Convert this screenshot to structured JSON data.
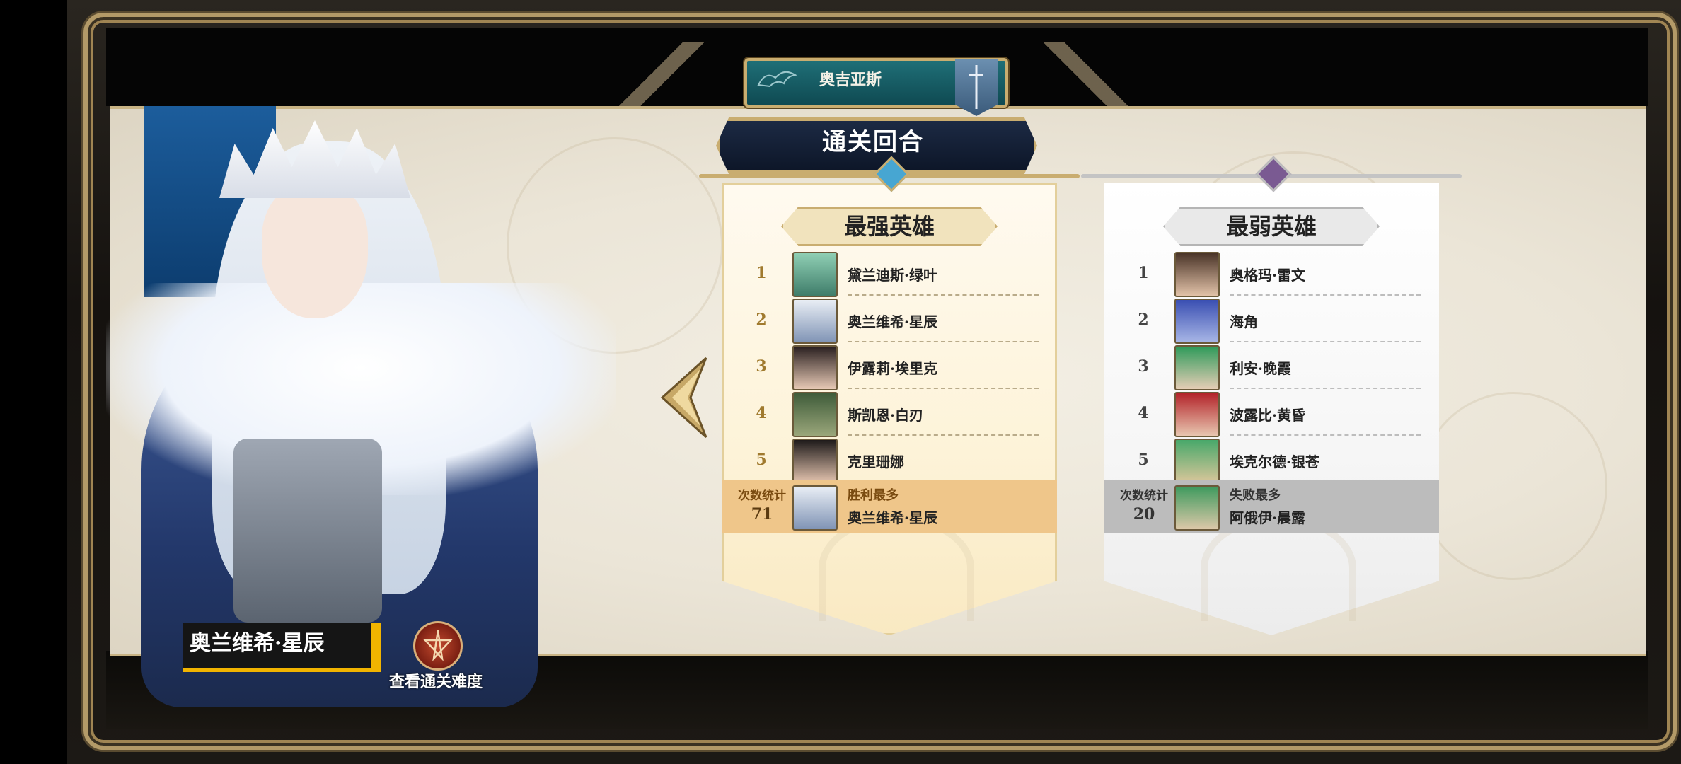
{
  "region": {
    "name": "奥吉亚斯"
  },
  "banner": {
    "title": "通关回合"
  },
  "strongest": {
    "title": "最强英雄",
    "heroes": [
      {
        "rank": "1",
        "name": "黛兰迪斯·绿叶"
      },
      {
        "rank": "2",
        "name": "奥兰维希·星辰"
      },
      {
        "rank": "3",
        "name": "伊露莉·埃里克"
      },
      {
        "rank": "4",
        "name": "斯凯恩·白刃"
      },
      {
        "rank": "5",
        "name": "克里珊娜"
      }
    ],
    "stat": {
      "label": "次数统计",
      "value": "71",
      "caption": "胜利最多",
      "hero": "奥兰维希·星辰"
    }
  },
  "weakest": {
    "title": "最弱英雄",
    "heroes": [
      {
        "rank": "1",
        "name": "奥格玛·雷文"
      },
      {
        "rank": "2",
        "name": "海角"
      },
      {
        "rank": "3",
        "name": "利安·晚霞"
      },
      {
        "rank": "4",
        "name": "波露比·黄昏"
      },
      {
        "rank": "5",
        "name": "埃克尔德·银苍"
      }
    ],
    "stat": {
      "label": "次数统计",
      "value": "20",
      "caption": "失败最多",
      "hero": "阿俄伊·晨露"
    }
  },
  "character": {
    "name": "奥兰维希·星辰"
  },
  "difficulty": {
    "label": "查看通关难度"
  },
  "icons": {
    "prev": "chevron-left-ornate-icon",
    "difficulty": "pentagram-seal-icon",
    "dragon": "dragon-emblem-icon"
  },
  "colors": {
    "gold": "#c9ad70",
    "strong_band": "#efc68a",
    "weak_band": "#bcbcbc",
    "banner_navy": "#1c2a44",
    "region_teal": "#1f6f77",
    "name_accent": "#f1b400"
  }
}
